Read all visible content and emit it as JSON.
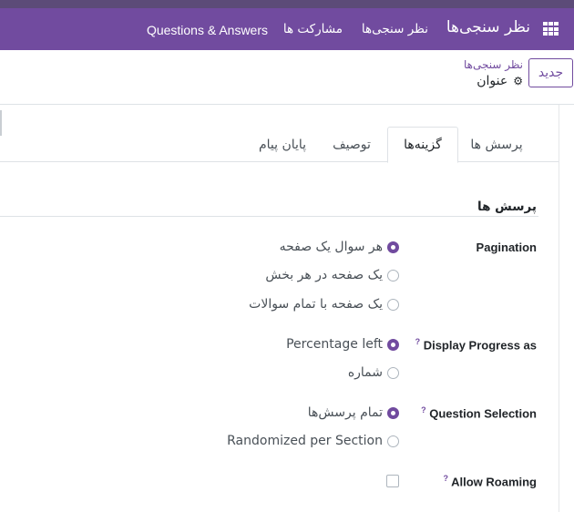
{
  "navbar": {
    "app_name": "نظر سنجی‌ها",
    "menu_items": [
      "نظر سنجی‌ها",
      "مشارکت ها",
      "Questions & Answers"
    ]
  },
  "control_panel": {
    "new_button": "جدید",
    "breadcrumb": "نظر سنجی‌ها",
    "record_name": "عنوان"
  },
  "tabs": [
    {
      "label": "پرسش ها",
      "active": false
    },
    {
      "label": "گزینه‌ها",
      "active": true
    },
    {
      "label": "توصیف",
      "active": false
    },
    {
      "label": "پایان پیام",
      "active": false
    }
  ],
  "section": {
    "title": "پرسش ها"
  },
  "fields": {
    "pagination": {
      "label": "Pagination",
      "options": [
        {
          "label": "هر سوال یک صفحه",
          "checked": true
        },
        {
          "label": "یک صفحه در هر بخش",
          "checked": false
        },
        {
          "label": "یک صفحه با تمام سوالات",
          "checked": false
        }
      ]
    },
    "progress": {
      "label": "Display Progress as",
      "help": "?",
      "options": [
        {
          "label": "Percentage left",
          "checked": true
        },
        {
          "label": "شماره",
          "checked": false
        }
      ]
    },
    "selection": {
      "label": "Question Selection",
      "help": "?",
      "options": [
        {
          "label": "تمام پرسش‌ها",
          "checked": true
        },
        {
          "label": "Randomized per Section",
          "checked": false
        }
      ]
    },
    "roaming": {
      "label": "Allow Roaming",
      "help": "?",
      "checked": false
    }
  },
  "colors": {
    "primary": "#714b9f",
    "topstrip": "#5c4b78"
  },
  "icons": {
    "apps": "grid-icon",
    "settings": "gear-icon"
  }
}
